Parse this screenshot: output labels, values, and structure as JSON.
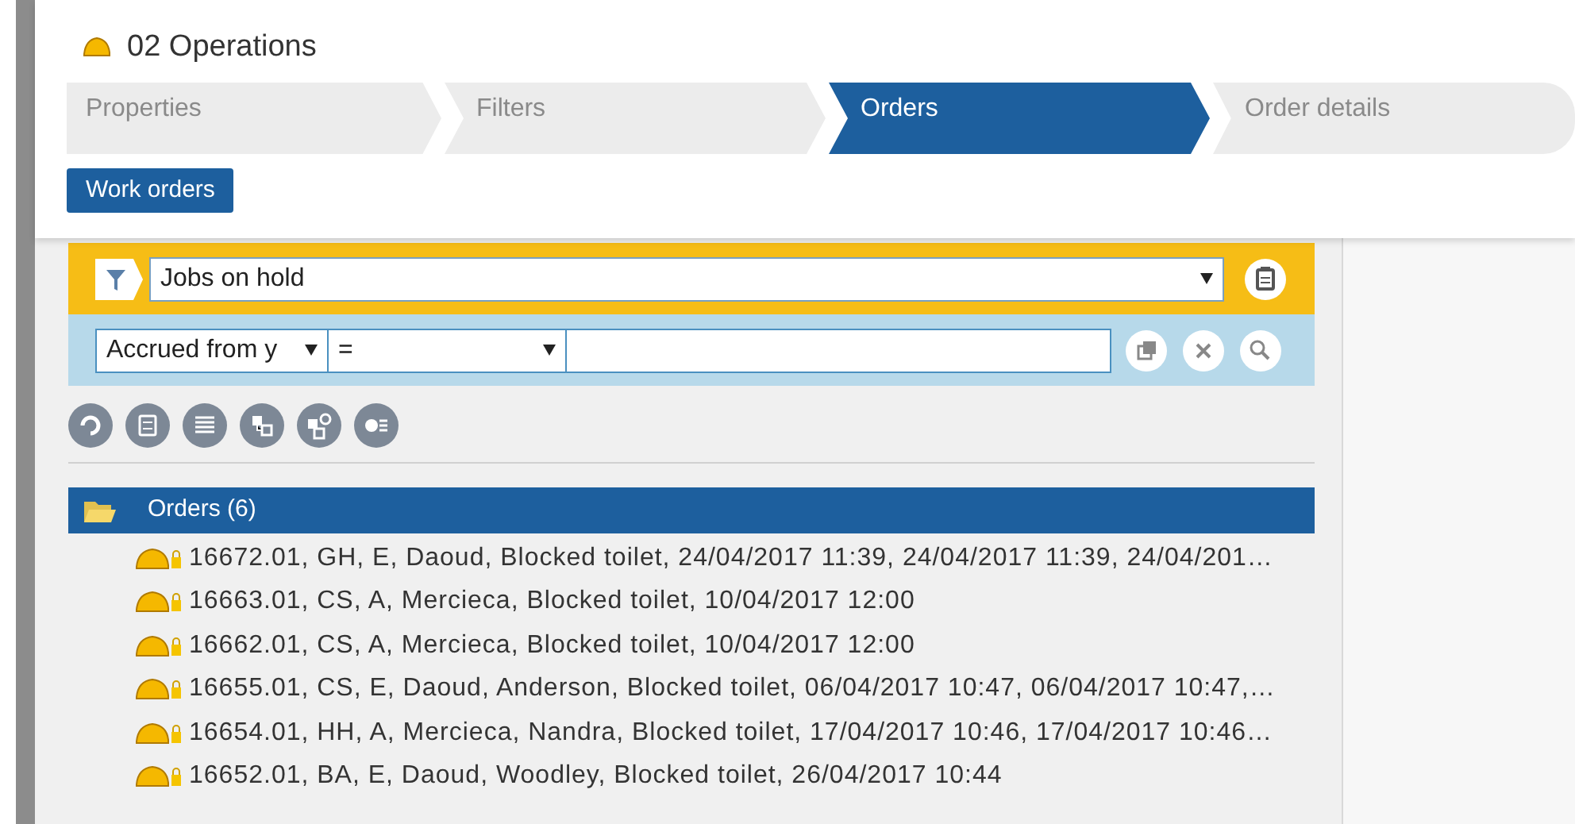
{
  "title": "02 Operations",
  "steps": [
    {
      "label": "Properties",
      "selected": false
    },
    {
      "label": "Filters",
      "selected": false
    },
    {
      "label": "Orders",
      "selected": true
    },
    {
      "label": "Order details",
      "selected": false
    }
  ],
  "view_button": "Work orders",
  "filter": {
    "value": "Jobs on hold"
  },
  "criteria": {
    "field": "Accrued from y",
    "operator": "="
  },
  "group": {
    "label": "Orders (6)",
    "rows": [
      "16672.01, GH, E, Daoud, Blocked toilet, 24/04/2017 11:39, 24/04/2017 11:39, 24/04/201…",
      "16663.01, CS, A, Mercieca, Blocked toilet, 10/04/2017 12:00",
      "16662.01, CS, A, Mercieca, Blocked toilet, 10/04/2017 12:00",
      "16655.01, CS, E, Daoud, Anderson, Blocked toilet, 06/04/2017 10:47, 06/04/2017 10:47,…",
      "16654.01, HH, A, Mercieca, Nandra, Blocked toilet, 17/04/2017 10:46, 17/04/2017 10:46…",
      "16652.01, BA, E, Daoud, Woodley, Blocked toilet, 26/04/2017 10:44"
    ]
  }
}
